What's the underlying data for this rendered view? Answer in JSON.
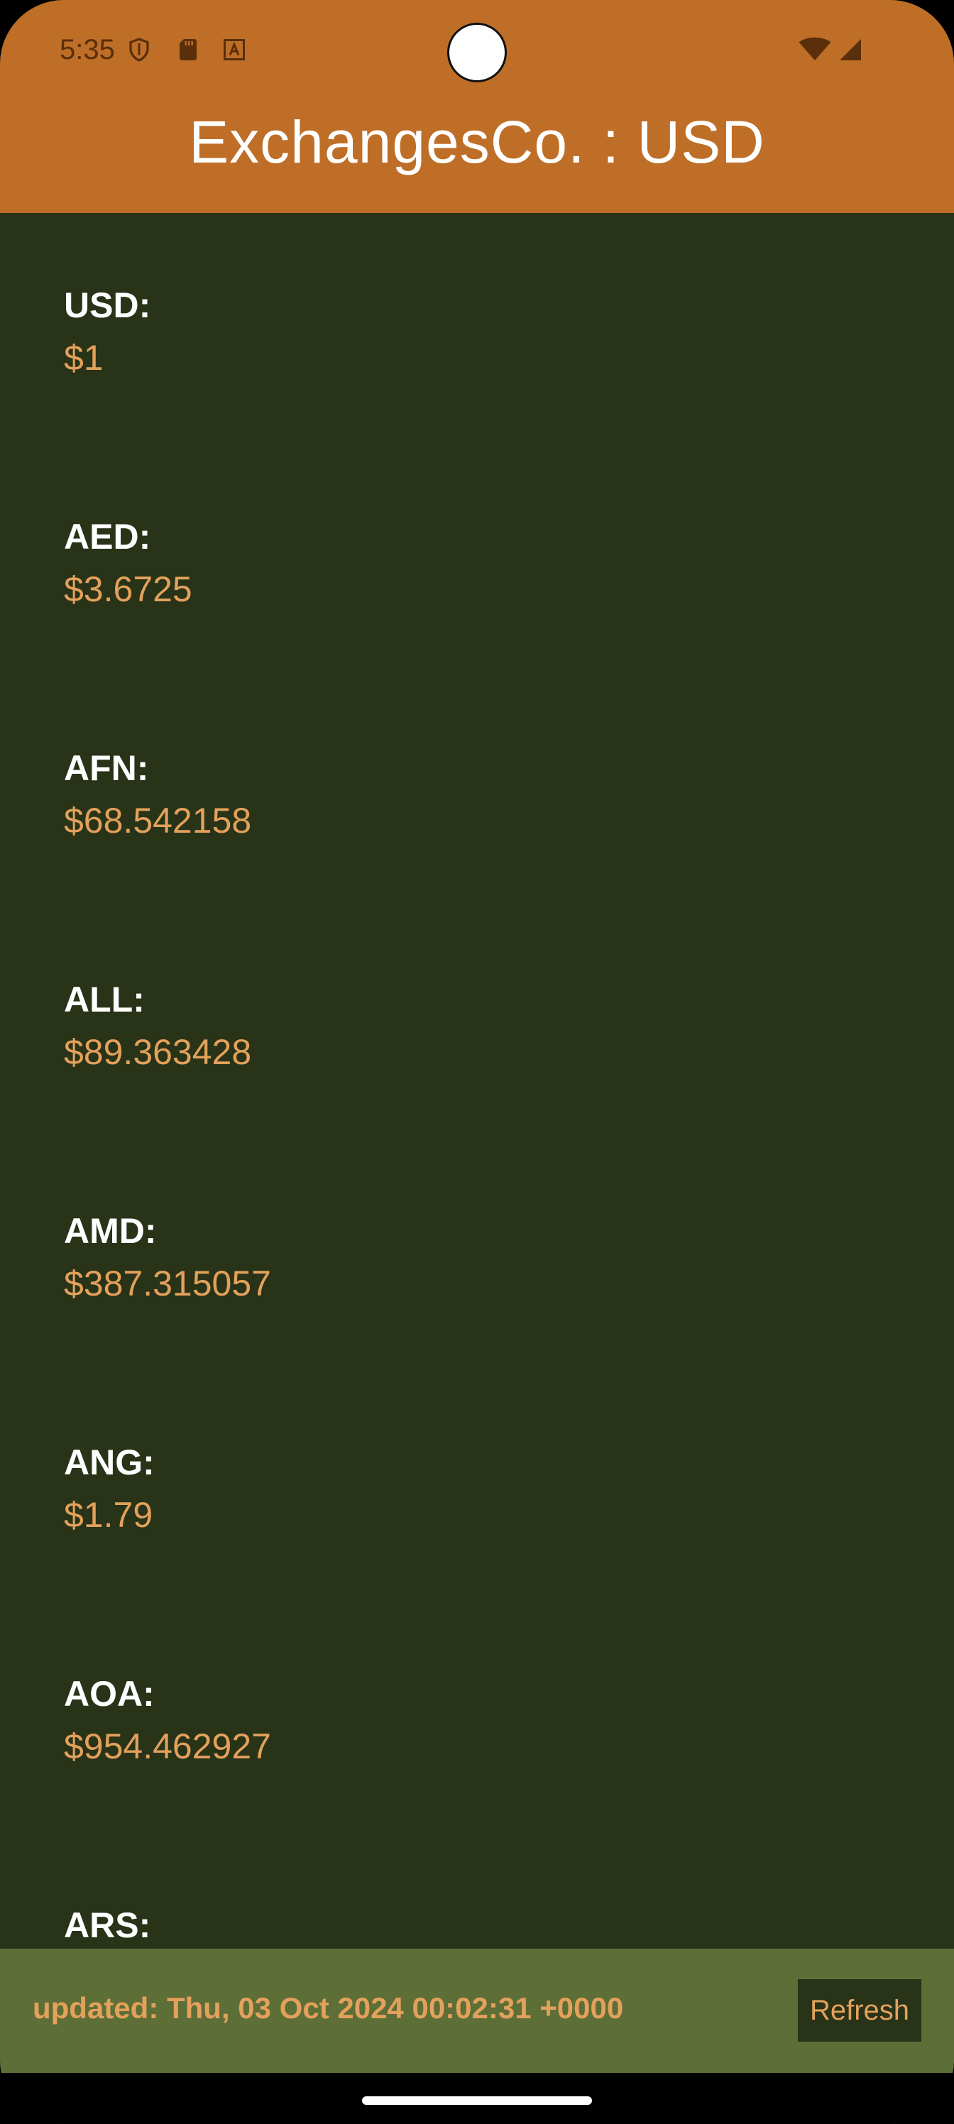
{
  "status_bar": {
    "time": "5:35",
    "icons": [
      "shield-icon",
      "sd-card-icon",
      "font-a-icon",
      "wifi-icon",
      "signal-icon"
    ]
  },
  "app_bar": {
    "title": "ExchangesCo. : USD"
  },
  "rates": [
    {
      "code": "USD:",
      "value": "$1"
    },
    {
      "code": "AED:",
      "value": "$3.6725"
    },
    {
      "code": "AFN:",
      "value": "$68.542158"
    },
    {
      "code": "ALL:",
      "value": "$89.363428"
    },
    {
      "code": "AMD:",
      "value": "$387.315057"
    },
    {
      "code": "ANG:",
      "value": "$1.79"
    },
    {
      "code": "AOA:",
      "value": "$954.462927"
    },
    {
      "code": "ARS:",
      "value": ""
    }
  ],
  "footer": {
    "updated": "updated: Thu, 03 Oct 2024 00:02:31 +0000",
    "refresh_label": "Refresh"
  },
  "colors": {
    "primary": "#BE6E27",
    "background": "#283318",
    "footer": "#5E6E37",
    "accent": "#E3A15B"
  }
}
